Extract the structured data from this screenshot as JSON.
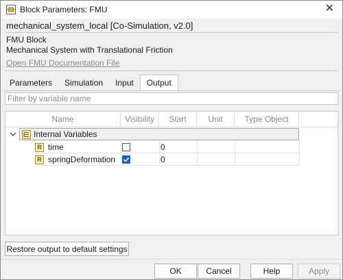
{
  "window": {
    "title": "Block Parameters: FMU",
    "close_glyph": "✕"
  },
  "header": {
    "model_line": "mechanical_system_local [Co-Simulation, v2.0]",
    "block_type": "FMU Block",
    "block_description": "Mechanical System with Translational Friction",
    "doc_link": "Open FMU Documentation File"
  },
  "tabs": [
    {
      "label": "Parameters",
      "active": false
    },
    {
      "label": "Simulation",
      "active": false
    },
    {
      "label": "Input",
      "active": false
    },
    {
      "label": "Output",
      "active": true
    }
  ],
  "filter": {
    "placeholder": "Filter by variable name",
    "value": ""
  },
  "grid": {
    "columns": [
      "Name",
      "Visibility",
      "Start",
      "Unit",
      "Type Object"
    ],
    "group": {
      "label": "Internal Variables",
      "expanded": true,
      "icon": "bus-element-icon",
      "chevron_glyph": "∨"
    },
    "rows": [
      {
        "type_badge": "R",
        "name": "time",
        "visible": false,
        "start": "0",
        "unit": "",
        "type_object": ""
      },
      {
        "type_badge": "R",
        "name": "springDeformation",
        "visible": true,
        "start": "0",
        "unit": "",
        "type_object": ""
      }
    ]
  },
  "restore_button": "Restore output to default settings",
  "buttons": {
    "ok": "OK",
    "cancel": "Cancel",
    "help": "Help",
    "apply": "Apply"
  },
  "colors": {
    "accent": "#1462c7",
    "link_disabled": "#8a8a8a"
  }
}
